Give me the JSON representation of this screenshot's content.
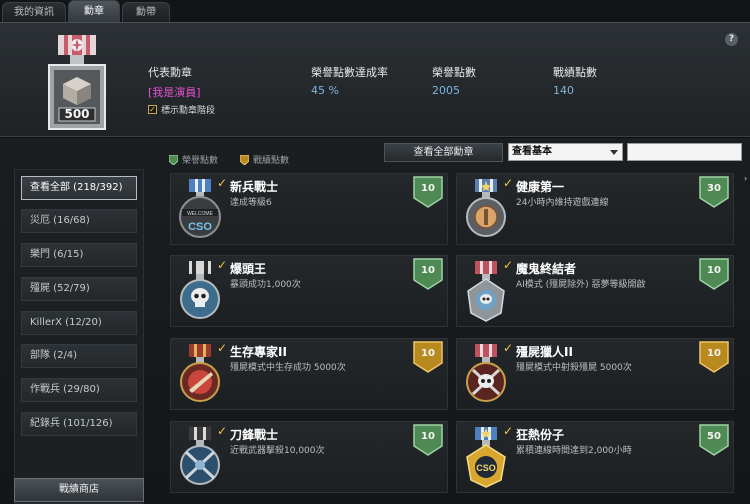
{
  "tabs": [
    {
      "label": "我的資訊"
    },
    {
      "label": "勳章"
    },
    {
      "label": "勳帶"
    }
  ],
  "summary": {
    "medal_badge_number": "500",
    "representative_label": "代表勳章",
    "representative_value": "[我是演員]",
    "show_stage_label": "標示勳章階段",
    "show_stage_checked": true,
    "completion_label": "榮譽點數達成率",
    "completion_value": "45 %",
    "honor_label": "榮譽點數",
    "honor_value": "2005",
    "record_label": "戰績點數",
    "record_value": "140",
    "help_label": "?"
  },
  "legend": {
    "honor": "榮譽點數",
    "record": "戰績點數"
  },
  "toolbar": {
    "view_all_label": "查看全部勳章",
    "filter_value": "查看基本",
    "search_value": ""
  },
  "categories": [
    {
      "label": "查看全部 (218/392)"
    },
    {
      "label": "災厄 (16/68)"
    },
    {
      "label": "樂門 (6/15)"
    },
    {
      "label": "殭屍 (52/79)"
    },
    {
      "label": "KillerX (12/20)"
    },
    {
      "label": "部隊 (2/4)"
    },
    {
      "label": "作戰兵 (29/80)"
    },
    {
      "label": "紀錄兵 (101/126)"
    }
  ],
  "shop_label": "戰績商店",
  "medals": [
    {
      "name": "新兵戰士",
      "desc": "達成等級6",
      "points": "10",
      "type": "honor",
      "icon": "welcome-cso-medal-icon",
      "icon_text": "CSO"
    },
    {
      "name": "健康第一",
      "desc": "24小時內維持遊戲連線",
      "points": "30",
      "type": "honor",
      "icon": "health-medal-icon"
    },
    {
      "name": "爆頭王",
      "desc": "暴頭成功1,000次",
      "points": "10",
      "type": "honor",
      "icon": "skull-headshot-medal-icon"
    },
    {
      "name": "魔鬼終結者",
      "desc": "AI模式 (殭屍除外) 惡夢等級開啟",
      "points": "10",
      "type": "honor",
      "icon": "terminator-medal-icon"
    },
    {
      "name": "生存專家II",
      "desc": "殭屍模式中生存成功 5000次",
      "points": "10",
      "type": "record",
      "icon": "survival-medal-icon"
    },
    {
      "name": "殭屍獵人II",
      "desc": "殭屍模式中射殺殭屍 5000次",
      "points": "10",
      "type": "record",
      "icon": "zombie-hunter-medal-icon"
    },
    {
      "name": "刀鋒戰士",
      "desc": "近戰武器擊殺10,000次",
      "points": "10",
      "type": "honor",
      "icon": "blade-medal-icon"
    },
    {
      "name": "狂熱份子",
      "desc": "累積連線時間達到2,000小時",
      "points": "50",
      "type": "honor",
      "icon": "gold-cso-medal-icon",
      "icon_text": "CSO"
    }
  ],
  "colors": {
    "honor_badge": "#4f8a55",
    "record_badge": "#b8891f",
    "pink_value": "#e54fd3",
    "blue_value": "#7fb4dc"
  }
}
